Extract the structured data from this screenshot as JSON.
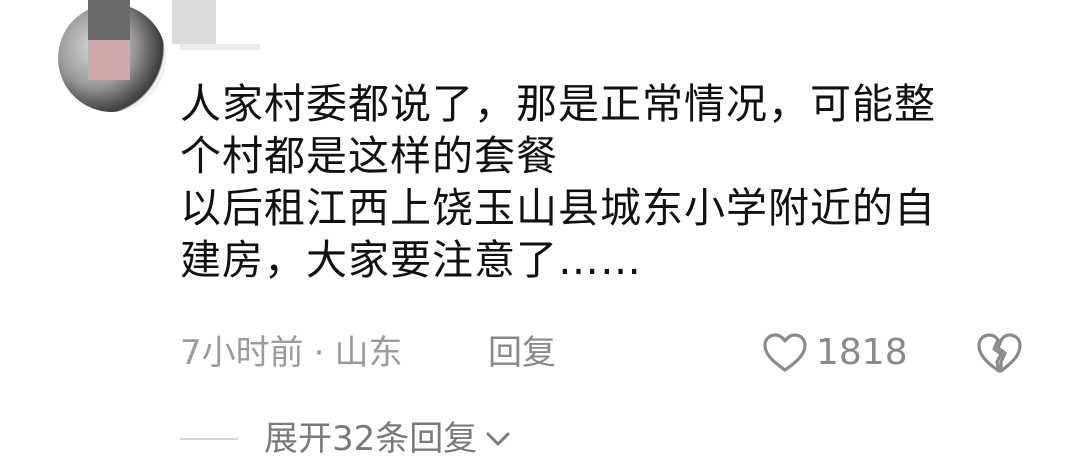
{
  "comment": {
    "lines": [
      "人家村委都说了，那是正常情况，可能整",
      "个村都是这样的套餐",
      "以后租江西上饶玉山县城东小学附近的自",
      "建房，大家要注意了……"
    ],
    "time": "7小时前",
    "separator": "·",
    "location": "山东",
    "reply_label": "回复",
    "like_count": "1818",
    "expand_label": "展开32条回复"
  },
  "icons": {
    "like": "heart-outline-icon",
    "dislike": "broken-heart-icon",
    "expand": "chevron-down-icon"
  }
}
